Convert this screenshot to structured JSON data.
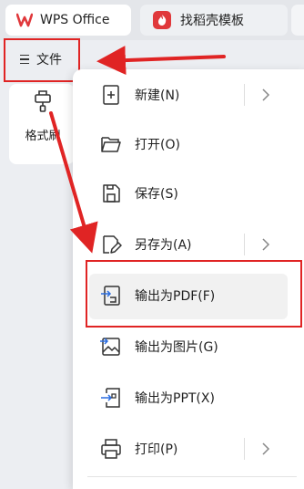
{
  "tabs": [
    {
      "label": "WPS Office",
      "icon": "wps-logo-icon"
    },
    {
      "label": "找稻壳模板",
      "icon": "docer-logo-icon"
    }
  ],
  "toolbar": {
    "file_menu_label": "文件"
  },
  "ribbon": {
    "format_painter_label": "格式刷"
  },
  "menu": {
    "items": [
      {
        "label": "新建(N)",
        "icon": "new-file-icon",
        "submenu": true
      },
      {
        "label": "打开(O)",
        "icon": "folder-open-icon",
        "submenu": false
      },
      {
        "label": "保存(S)",
        "icon": "save-icon",
        "submenu": false
      },
      {
        "label": "另存为(A)",
        "icon": "save-as-icon",
        "submenu": true
      },
      {
        "label": "输出为PDF(F)",
        "icon": "export-pdf-icon",
        "submenu": false,
        "highlighted": true
      },
      {
        "label": "输出为图片(G)",
        "icon": "export-image-icon",
        "submenu": false
      },
      {
        "label": "输出为PPT(X)",
        "icon": "export-ppt-icon",
        "submenu": false
      },
      {
        "label": "打印(P)",
        "icon": "printer-icon",
        "submenu": true
      }
    ]
  },
  "colors": {
    "annotation_red": "#e02424",
    "wps_red": "#e0383b",
    "menu_hover": "#f1f1f1"
  }
}
